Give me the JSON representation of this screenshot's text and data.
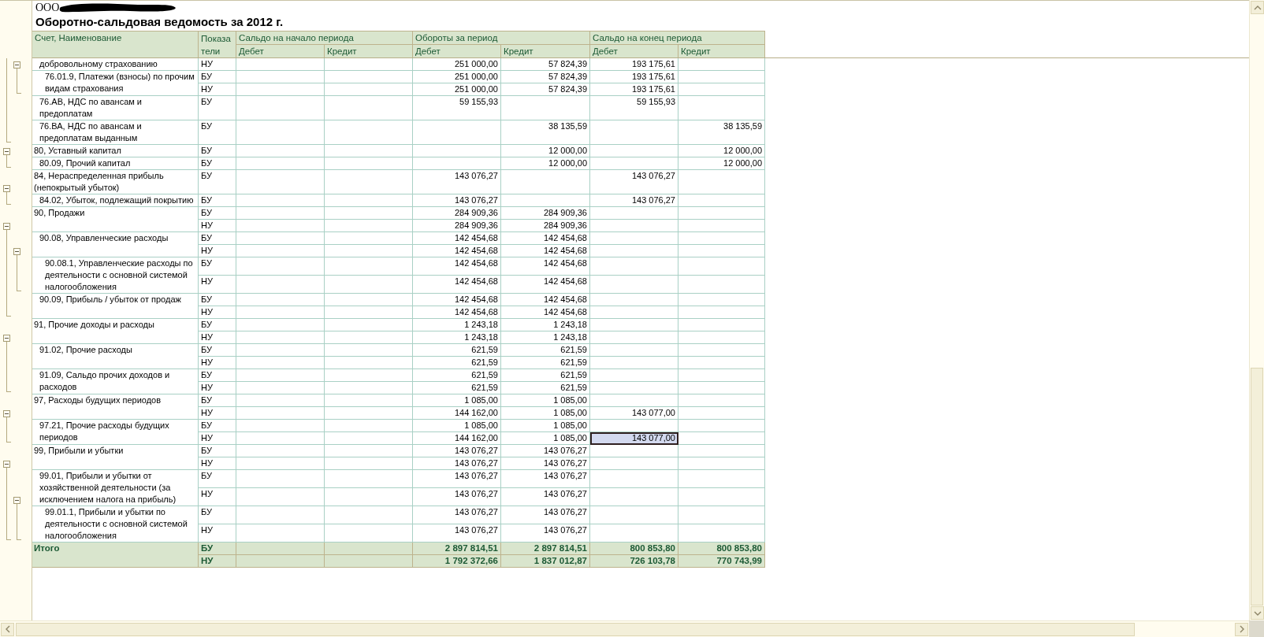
{
  "organization": {
    "name": "ООО"
  },
  "report": {
    "title": "Оборотно-сальдовая ведомость за 2012 г."
  },
  "columns": {
    "account": "Счет, Наименование",
    "indicators": "Показатели",
    "groups": [
      {
        "title": "Сальдо на начало периода",
        "debit": "Дебет",
        "credit": "Кредит"
      },
      {
        "title": "Обороты за период",
        "debit": "Дебет",
        "credit": "Кредит"
      },
      {
        "title": "Сальдо на конец периода",
        "debit": "Дебет",
        "credit": "Кредит"
      }
    ]
  },
  "accounts": [
    {
      "children": [
        {
          "name": "добровольному страхованию",
          "rows": [
            {
              "indicator": "НУ",
              "turnover_debit": "251 000,00",
              "turnover_credit": "57 824,39",
              "closing_debit": "193 175,61"
            }
          ],
          "children": [
            {
              "name": "76.01.9, Платежи (взносы) по прочим видам страхования",
              "rows": [
                {
                  "indicator": "БУ",
                  "turnover_debit": "251 000,00",
                  "turnover_credit": "57 824,39",
                  "closing_debit": "193 175,61"
                },
                {
                  "indicator": "НУ",
                  "turnover_debit": "251 000,00",
                  "turnover_credit": "57 824,39",
                  "closing_debit": "193 175,61"
                }
              ]
            }
          ]
        },
        {
          "name": "76.АВ, НДС по авансам и предоплатам",
          "rows": [
            {
              "indicator": "БУ",
              "turnover_debit": "59 155,93",
              "closing_debit": "59 155,93"
            }
          ]
        },
        {
          "name": "76.ВА, НДС по авансам и предоплатам выданным",
          "rows": [
            {
              "indicator": "БУ",
              "turnover_credit": "38 135,59",
              "closing_credit": "38 135,59"
            }
          ]
        }
      ]
    },
    {
      "name": "80, Уставный капитал",
      "rows": [
        {
          "indicator": "БУ",
          "turnover_credit": "12 000,00",
          "closing_credit": "12 000,00"
        }
      ],
      "children": [
        {
          "name": "80.09, Прочий капитал",
          "rows": [
            {
              "indicator": "БУ",
              "turnover_credit": "12 000,00",
              "closing_credit": "12 000,00"
            }
          ]
        }
      ]
    },
    {
      "name": "84, Нераспределенная прибыль (непокрытый убыток)",
      "rows": [
        {
          "indicator": "БУ",
          "turnover_debit": "143 076,27",
          "closing_debit": "143 076,27"
        }
      ],
      "children": [
        {
          "name": "84.02, Убыток, подлежащий покрытию",
          "rows": [
            {
              "indicator": "БУ",
              "turnover_debit": "143 076,27",
              "closing_debit": "143 076,27"
            }
          ]
        }
      ]
    },
    {
      "name": "90, Продажи",
      "rows": [
        {
          "indicator": "БУ",
          "turnover_debit": "284 909,36",
          "turnover_credit": "284 909,36"
        },
        {
          "indicator": "НУ",
          "turnover_debit": "284 909,36",
          "turnover_credit": "284 909,36"
        }
      ],
      "children": [
        {
          "name": "90.08, Управленческие расходы",
          "rows": [
            {
              "indicator": "БУ",
              "turnover_debit": "142 454,68",
              "turnover_credit": "142 454,68"
            },
            {
              "indicator": "НУ",
              "turnover_debit": "142 454,68",
              "turnover_credit": "142 454,68"
            }
          ],
          "children": [
            {
              "name": "90.08.1, Управленческие расходы по деятельности с основной системой налогообложения",
              "rows": [
                {
                  "indicator": "БУ",
                  "turnover_debit": "142 454,68",
                  "turnover_credit": "142 454,68"
                },
                {
                  "indicator": "НУ",
                  "turnover_debit": "142 454,68",
                  "turnover_credit": "142 454,68"
                }
              ]
            }
          ]
        },
        {
          "name": "90.09, Прибыль / убыток от продаж",
          "rows": [
            {
              "indicator": "БУ",
              "turnover_debit": "142 454,68",
              "turnover_credit": "142 454,68"
            },
            {
              "indicator": "НУ",
              "turnover_debit": "142 454,68",
              "turnover_credit": "142 454,68"
            }
          ]
        }
      ]
    },
    {
      "name": "91, Прочие доходы и расходы",
      "rows": [
        {
          "indicator": "БУ",
          "turnover_debit": "1 243,18",
          "turnover_credit": "1 243,18"
        },
        {
          "indicator": "НУ",
          "turnover_debit": "1 243,18",
          "turnover_credit": "1 243,18"
        }
      ],
      "children": [
        {
          "name": "91.02, Прочие расходы",
          "rows": [
            {
              "indicator": "БУ",
              "turnover_debit": "621,59",
              "turnover_credit": "621,59"
            },
            {
              "indicator": "НУ",
              "turnover_debit": "621,59",
              "turnover_credit": "621,59"
            }
          ]
        },
        {
          "name": "91.09, Сальдо прочих доходов и расходов",
          "rows": [
            {
              "indicator": "БУ",
              "turnover_debit": "621,59",
              "turnover_credit": "621,59"
            },
            {
              "indicator": "НУ",
              "turnover_debit": "621,59",
              "turnover_credit": "621,59"
            }
          ]
        }
      ]
    },
    {
      "name": "97, Расходы будущих периодов",
      "rows": [
        {
          "indicator": "БУ",
          "turnover_debit": "1 085,00",
          "turnover_credit": "1 085,00"
        },
        {
          "indicator": "НУ",
          "turnover_debit": "144 162,00",
          "turnover_credit": "1 085,00",
          "closing_debit": "143 077,00"
        }
      ],
      "children": [
        {
          "name": "97.21, Прочие расходы будущих периодов",
          "rows": [
            {
              "indicator": "БУ",
              "turnover_debit": "1 085,00",
              "turnover_credit": "1 085,00"
            },
            {
              "indicator": "НУ",
              "turnover_debit": "144 162,00",
              "turnover_credit": "1 085,00",
              "closing_debit": {
                "text": "143 077,00",
                "selected": true
              }
            }
          ]
        }
      ]
    },
    {
      "name": "99, Прибыли и убытки",
      "rows": [
        {
          "indicator": "БУ",
          "turnover_debit": "143 076,27",
          "turnover_credit": "143 076,27"
        },
        {
          "indicator": "НУ",
          "turnover_debit": "143 076,27",
          "turnover_credit": "143 076,27"
        }
      ],
      "children": [
        {
          "name": "99.01, Прибыли и убытки от хозяйственной деятельности (за исключением налога на прибыль)",
          "rows": [
            {
              "indicator": "БУ",
              "turnover_debit": "143 076,27",
              "turnover_credit": "143 076,27"
            },
            {
              "indicator": "НУ",
              "turnover_debit": "143 076,27",
              "turnover_credit": "143 076,27"
            }
          ],
          "children": [
            {
              "name": "99.01.1, Прибыли и убытки по деятельности с основной системой налогообложения",
              "rows": [
                {
                  "indicator": "БУ",
                  "turnover_debit": "143 076,27",
                  "turnover_credit": "143 076,27"
                },
                {
                  "indicator": "НУ",
                  "turnover_debit": "143 076,27",
                  "turnover_credit": "143 076,27"
                }
              ]
            }
          ]
        }
      ]
    }
  ],
  "totals": {
    "label": "Итого",
    "rows": [
      {
        "indicator": "БУ",
        "turnover_debit": "2 897 814,51",
        "turnover_credit": "2 897 814,51",
        "closing_debit": "800 853,80",
        "closing_credit": "800 853,80"
      },
      {
        "indicator": "НУ",
        "turnover_debit": "1 792 372,66",
        "turnover_credit": "1 837 012,87",
        "closing_debit": "726 103,78",
        "closing_credit": "770 743,99"
      }
    ]
  }
}
